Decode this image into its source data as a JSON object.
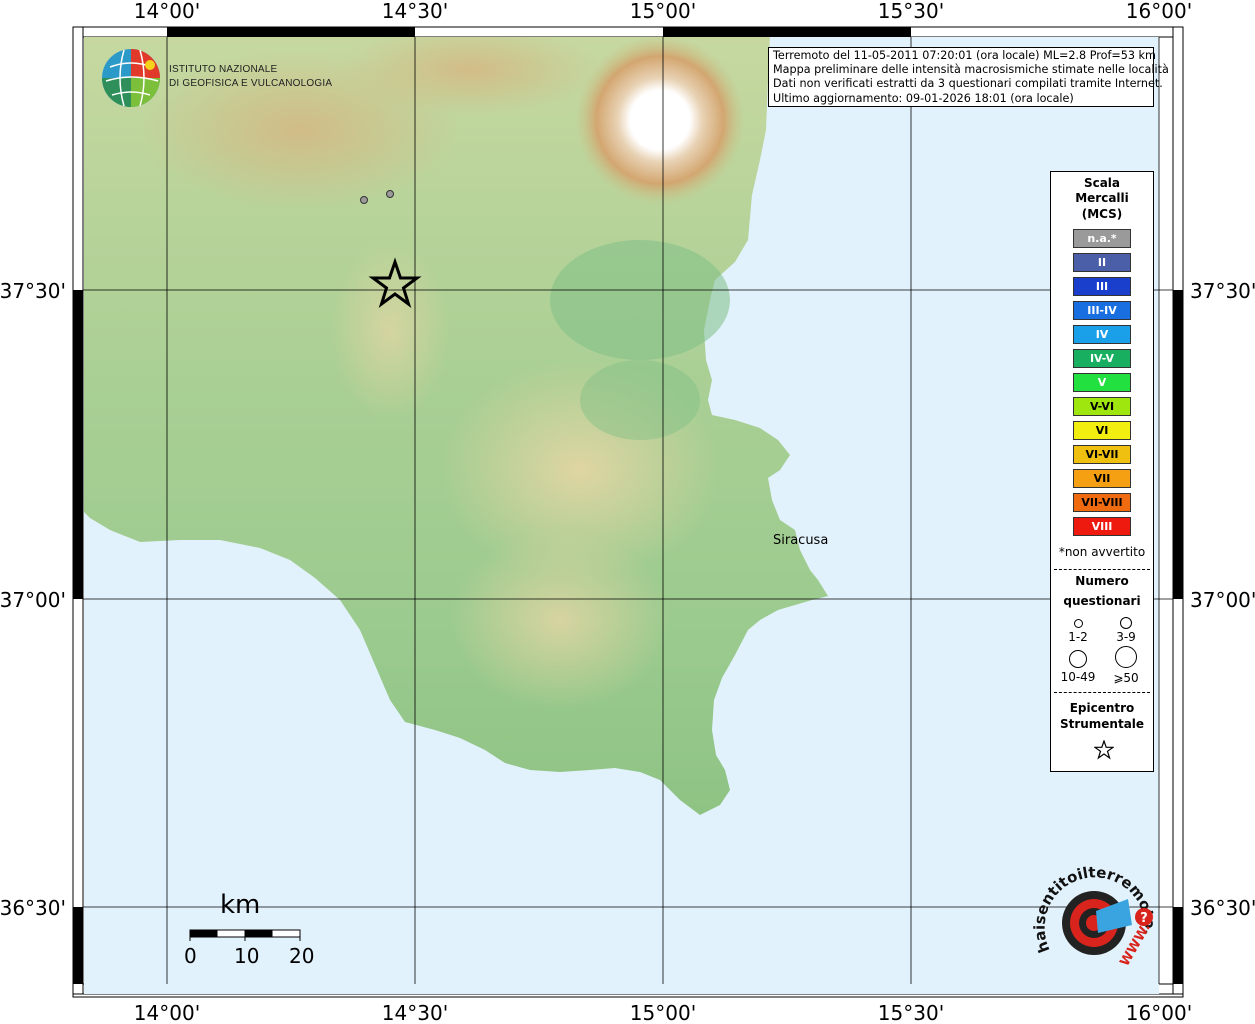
{
  "map": {
    "lon_labels": [
      "14°00'",
      "14°30'",
      "15°00'",
      "15°30'",
      "16°00'"
    ],
    "lat_labels": [
      "37°30'",
      "37°00'",
      "36°30'"
    ],
    "city": "Siracusa",
    "colors": {
      "sea": "#e2f2fc",
      "land_low": "#89c48a",
      "land_mid": "#c7d99a",
      "land_high": "#d9b888",
      "peak": "#ffffff"
    }
  },
  "logo": {
    "line1": "ISTITUTO NAZIONALE",
    "line2": "DI GEOFISICA E VULCANOLOGIA"
  },
  "info": {
    "line1": "Terremoto del 11-05-2011 07:20:01 (ora locale) ML=2.8 Prof=53 km",
    "line2": "Mappa preliminare delle intensità macrosismiche stimate nelle località",
    "line3": "Dati non verificati estratti da 3 questionari compilati tramite Internet.",
    "line4": "Ultimo aggiornamento: 09-01-2026 18:01 (ora locale)"
  },
  "legend": {
    "title": [
      "Scala",
      "Mercalli",
      "(MCS)"
    ],
    "scale": [
      {
        "label": "n.a.*",
        "color": "#9a9a9a"
      },
      {
        "label": "II",
        "color": "#4a5fa8"
      },
      {
        "label": "III",
        "color": "#1a3fcc"
      },
      {
        "label": "III-IV",
        "color": "#1a6fe0"
      },
      {
        "label": "IV",
        "color": "#1aa0e8"
      },
      {
        "label": "IV-V",
        "color": "#18b060"
      },
      {
        "label": "V",
        "color": "#22e040"
      },
      {
        "label": "V-VI",
        "color": "#9ee60e"
      },
      {
        "label": "VI",
        "color": "#f2ee10"
      },
      {
        "label": "VI-VII",
        "color": "#f0c010"
      },
      {
        "label": "VII",
        "color": "#f5a012"
      },
      {
        "label": "VII-VIII",
        "color": "#f06a10"
      },
      {
        "label": "VIII",
        "color": "#ee1a10"
      }
    ],
    "note": "*non avvertito",
    "questionnaire_title": [
      "Numero",
      "questionari"
    ],
    "sizes": [
      "1-2",
      "3-9",
      "10-49",
      "⩾50"
    ],
    "epicenter_title": [
      "Epicentro",
      "Strumentale"
    ]
  },
  "scalebar": {
    "unit": "km",
    "labels": [
      "0",
      "10",
      "20"
    ]
  },
  "hai_logo": {
    "text": "haisentitoilterremoto.it",
    "url_text": "WWW."
  }
}
